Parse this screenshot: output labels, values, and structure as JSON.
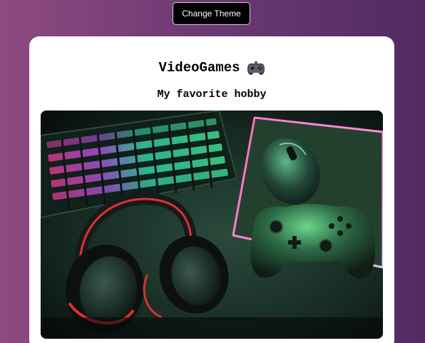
{
  "header": {
    "theme_button_label": "Change Theme"
  },
  "card": {
    "title": "VideoGames",
    "title_icon": "gamepad-icon",
    "subtitle": "My favorite hobby",
    "image_icon": "gaming-setup-photo"
  },
  "colors": {
    "background_start": "#8e4a80",
    "background_end": "#532a63",
    "card": "#ffffff",
    "button": "#000000"
  }
}
